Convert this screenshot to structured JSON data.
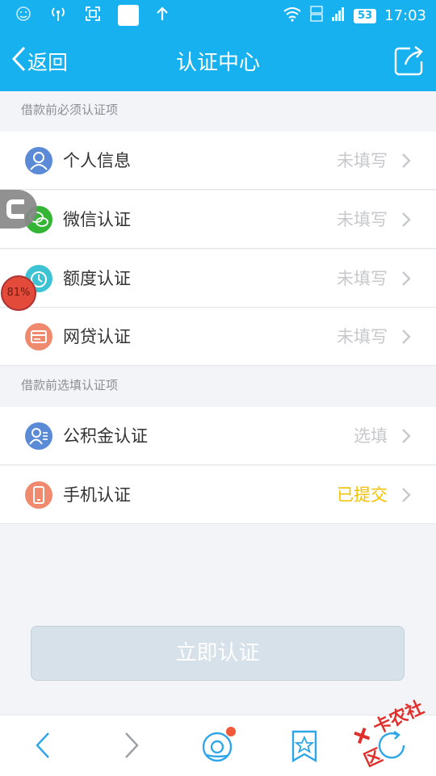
{
  "status_bar": {
    "battery": "53",
    "time": "17:03"
  },
  "header": {
    "back_label": "返回",
    "title": "认证中心"
  },
  "sections": [
    {
      "label": "借款前必须认证项"
    },
    {
      "label": "借款前选填认证项"
    }
  ],
  "required_items": [
    {
      "label": "个人信息",
      "status": "未填写",
      "icon": "person-icon",
      "color": "#5b8ad7"
    },
    {
      "label": "微信认证",
      "status": "未填写",
      "icon": "wechat-icon",
      "color": "#35b535"
    },
    {
      "label": "额度认证",
      "status": "未填写",
      "icon": "quota-icon",
      "color": "#3ec3d4"
    },
    {
      "label": "网贷认证",
      "status": "未填写",
      "icon": "loan-card-icon",
      "color": "#f08a6e"
    }
  ],
  "optional_items": [
    {
      "label": "公积金认证",
      "status": "选填",
      "icon": "fund-user-icon",
      "color": "#5b8ad7"
    },
    {
      "label": "手机认证",
      "status": "已提交",
      "icon": "phone-icon",
      "color": "#f08a6e",
      "status_color": "#f2c200"
    }
  ],
  "action": {
    "submit_label": "立即认证"
  },
  "overlay": {
    "progress_badge": "81%",
    "watermark": "卡农社区"
  },
  "colors": {
    "primary": "#18b1f0",
    "disabled_button": "#d6e1ea",
    "browser_icon": "#2ea6e8",
    "notification_dot": "#f05a3a"
  }
}
